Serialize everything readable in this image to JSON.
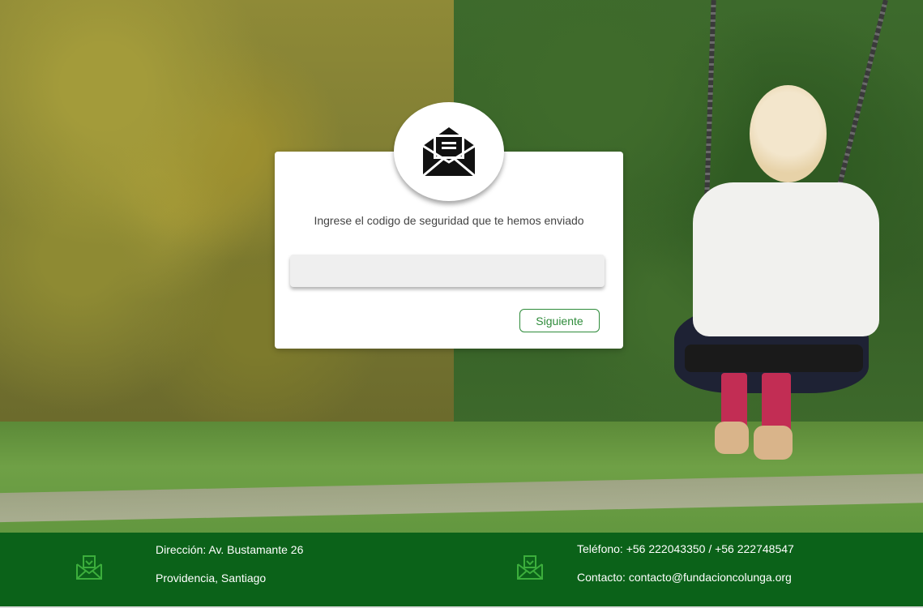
{
  "dialog": {
    "icon": "open-envelope-icon",
    "prompt": "Ingrese el codigo de seguridad que te hemos enviado",
    "code_input": {
      "value": "",
      "placeholder": ""
    },
    "next_label": "Siguiente"
  },
  "footer": {
    "address_icon": "mail-inbox-icon",
    "address_line1": "Dirección: Av. Bustamante 26",
    "address_line2": "Providencia, Santiago",
    "contact_icon": "mail-inbox-icon",
    "phone_line": "Teléfono:  +56 222043350 /  +56 222748547",
    "email_line": "Contacto: contacto@fundacioncolunga.org"
  },
  "colors": {
    "footer_bg": "#0b6219",
    "accent_green": "#2e8b3a",
    "card_bg": "#ffffff"
  }
}
